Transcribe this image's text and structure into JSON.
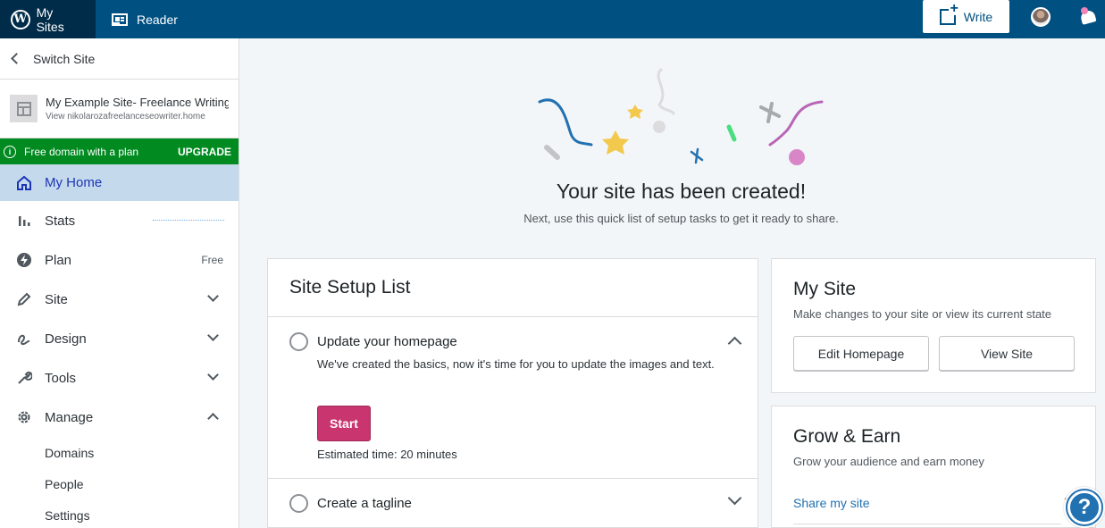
{
  "masterbar": {
    "my_sites": "My Sites",
    "reader": "Reader",
    "write": "Write"
  },
  "sidebar": {
    "switch_site": "Switch Site",
    "site_name": "My Example Site- Freelance Writing",
    "site_url": "View nikolarozafreelanceseowriter.home",
    "upgrade_banner": {
      "text": "Free domain with a plan",
      "action": "UPGRADE"
    },
    "items": [
      {
        "label": "My Home",
        "icon": "home-icon",
        "selected": true
      },
      {
        "label": "Stats",
        "icon": "stats-icon"
      },
      {
        "label": "Plan",
        "icon": "plan-icon",
        "badge": "Free"
      },
      {
        "label": "Site",
        "icon": "pencil-icon",
        "expand": "collapsed"
      },
      {
        "label": "Design",
        "icon": "design-icon",
        "expand": "collapsed"
      },
      {
        "label": "Tools",
        "icon": "wrench-icon",
        "expand": "collapsed"
      },
      {
        "label": "Manage",
        "icon": "gear-icon",
        "expand": "expanded"
      }
    ],
    "sub_items": [
      "Domains",
      "People",
      "Settings"
    ]
  },
  "hero": {
    "title": "Your site has been created!",
    "subtitle": "Next, use this quick list of setup tasks to get it ready to share."
  },
  "setup_list": {
    "title": "Site Setup List",
    "tasks": [
      {
        "title": "Update your homepage",
        "description": "We've created the basics, now it's time for you to update the images and text.",
        "button": "Start",
        "time": "Estimated time: 20 minutes",
        "expanded": true
      },
      {
        "title": "Create a tagline",
        "expanded": false
      }
    ]
  },
  "my_site": {
    "title": "My Site",
    "subtitle": "Make changes to your site or view its current state",
    "edit_button": "Edit Homepage",
    "view_button": "View Site"
  },
  "grow_earn": {
    "title": "Grow & Earn",
    "subtitle": "Grow your audience and earn money",
    "link": "Share my site"
  },
  "colors": {
    "masterbar": "#005082",
    "masterbar_active": "#002c4a",
    "upgrade_banner": "#008a20",
    "selected_nav": "#c5d9ed",
    "start_button": "#c9356e",
    "link": "#2271b1"
  }
}
